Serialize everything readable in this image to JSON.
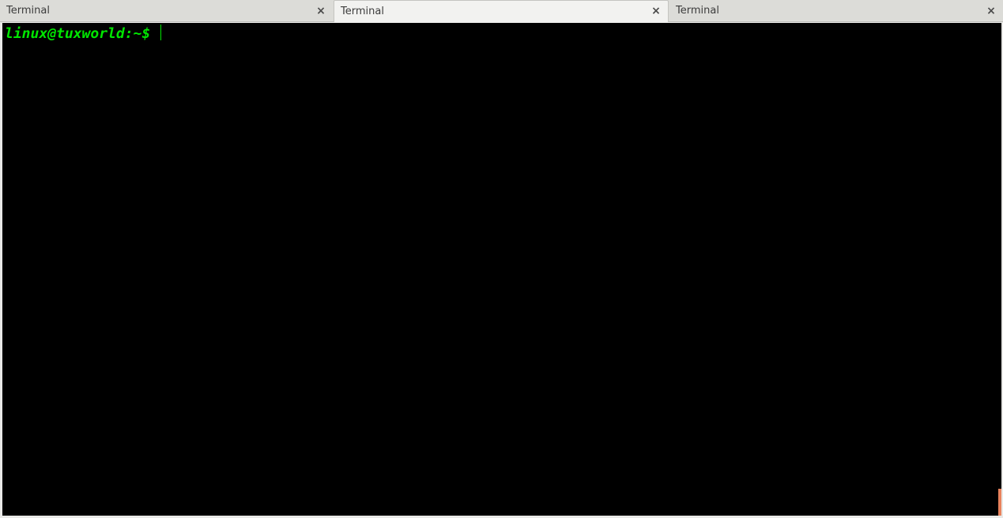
{
  "tabs": [
    {
      "label": "Terminal",
      "close_glyph": "×",
      "active": false
    },
    {
      "label": "Terminal",
      "close_glyph": "×",
      "active": true
    },
    {
      "label": "Terminal",
      "close_glyph": "×",
      "active": false
    }
  ],
  "terminal": {
    "prompt": "linux@tuxworld:~$ ",
    "input": "",
    "colors": {
      "background": "#000000",
      "prompt": "#00e600",
      "cursor": "#00e600",
      "scroll_indicator": "#e8825c"
    }
  }
}
